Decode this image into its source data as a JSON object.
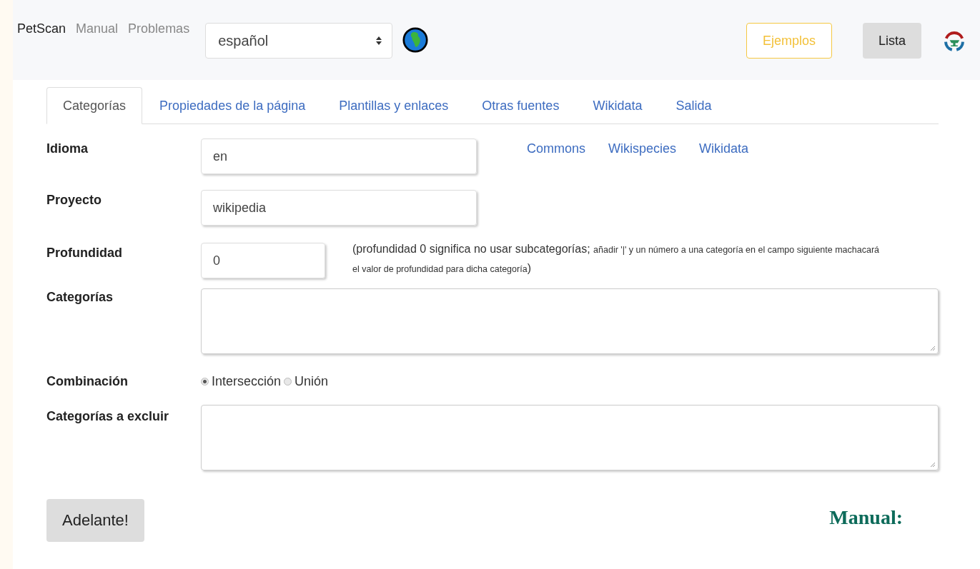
{
  "navbar": {
    "brand": "PetScan",
    "links": [
      "Manual",
      "Problemas"
    ],
    "language": {
      "value": "español"
    },
    "buttons": [
      {
        "label": "Ejemplos",
        "kind": "outline"
      },
      {
        "label": "Lista",
        "kind": "filled"
      }
    ]
  },
  "tabs": [
    {
      "label": "Categorías",
      "selected": true
    },
    {
      "label": "Propiedades de la página",
      "selected": false
    },
    {
      "label": "Plantillas y enlaces",
      "selected": false
    },
    {
      "label": "Otras fuentes",
      "selected": false
    },
    {
      "label": "Wikidata",
      "selected": false
    },
    {
      "label": "Salida",
      "selected": false
    }
  ],
  "form": [
    {
      "kind": "input",
      "label": "Idioma",
      "value": "en",
      "links": [
        "Commons",
        "Wikispecies",
        "Wikidata"
      ]
    },
    {
      "kind": "input",
      "label": "Proyecto",
      "value": "wikipedia"
    },
    {
      "kind": "short",
      "label": "Profundidad",
      "value": "0",
      "note": {
        "main": "(profundidad 0 significa no usar subcategorías;",
        "detail": "añadir '|' y un número a una categoría en el campo siguiente machacará el valor de profundidad para dicha categoría",
        "end": ")"
      }
    },
    {
      "kind": "textarea",
      "label": "Categorías"
    },
    {
      "kind": "radio",
      "label": "Combinación",
      "options": [
        {
          "label": "Intersección",
          "selected": true
        },
        {
          "label": "Unión",
          "selected": false
        }
      ]
    },
    {
      "kind": "textarea",
      "label": "Categorías a excluir"
    }
  ],
  "submit": "Adelante!",
  "overlay": {
    "text": "Manual:"
  }
}
